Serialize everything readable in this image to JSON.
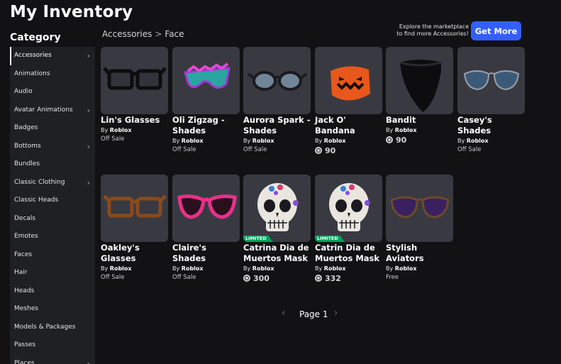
{
  "page_title": "My Inventory",
  "sidebar": {
    "heading": "Category",
    "items": [
      {
        "label": "Accessories",
        "chevron": true
      },
      {
        "label": "Animations",
        "chevron": false
      },
      {
        "label": "Audio",
        "chevron": false
      },
      {
        "label": "Avatar Animations",
        "chevron": true
      },
      {
        "label": "Badges",
        "chevron": false
      },
      {
        "label": "Bottoms",
        "chevron": true
      },
      {
        "label": "Bundles",
        "chevron": false
      },
      {
        "label": "Classic Clothing",
        "chevron": true
      },
      {
        "label": "Classic Heads",
        "chevron": false
      },
      {
        "label": "Decals",
        "chevron": false
      },
      {
        "label": "Emotes",
        "chevron": false
      },
      {
        "label": "Faces",
        "chevron": false
      },
      {
        "label": "Hair",
        "chevron": false
      },
      {
        "label": "Heads",
        "chevron": false
      },
      {
        "label": "Meshes",
        "chevron": false
      },
      {
        "label": "Models & Packages",
        "chevron": false
      },
      {
        "label": "Passes",
        "chevron": false
      },
      {
        "label": "Places",
        "chevron": true
      }
    ]
  },
  "breadcrumb": {
    "parent": "Accessories",
    "separator": ">",
    "current": "Face"
  },
  "promo": {
    "line1": "Explore the marketplace",
    "line2": "to find more Accessories!",
    "button": "Get More"
  },
  "items": [
    {
      "name": "Lin's Glasses",
      "by_prefix": "By",
      "creator": "Roblox",
      "price": "Off Sale",
      "robux": false,
      "limited": false,
      "icon": "black-glasses"
    },
    {
      "name": "Oli Zigzag - Shades",
      "by_prefix": "By",
      "creator": "Roblox",
      "price": "Off Sale",
      "robux": false,
      "limited": false,
      "icon": "zigzag-shades"
    },
    {
      "name": "Aurora Spark - Shades",
      "by_prefix": "By",
      "creator": "Roblox",
      "price": "Off Sale",
      "robux": false,
      "limited": false,
      "icon": "round-shades"
    },
    {
      "name": "Jack O' Bandana",
      "by_prefix": "By",
      "creator": "Roblox",
      "price": "90",
      "robux": true,
      "limited": false,
      "icon": "pumpkin-bandana"
    },
    {
      "name": "Bandit",
      "by_prefix": "By",
      "creator": "Roblox",
      "price": "90",
      "robux": true,
      "limited": false,
      "icon": "black-bandana"
    },
    {
      "name": "Casey's Shades",
      "by_prefix": "By",
      "creator": "Roblox",
      "price": "Off Sale",
      "robux": false,
      "limited": false,
      "icon": "aviator-shades"
    },
    {
      "name": "Oakley's Glasses",
      "by_prefix": "By",
      "creator": "Roblox",
      "price": "Off Sale",
      "robux": false,
      "limited": false,
      "icon": "brown-glasses"
    },
    {
      "name": "Claire's Shades",
      "by_prefix": "By",
      "creator": "Roblox",
      "price": "Off Sale",
      "robux": false,
      "limited": false,
      "icon": "pink-shades"
    },
    {
      "name": "Catrina Dia de Muertos Mask",
      "by_prefix": "By",
      "creator": "Roblox",
      "price": "300",
      "robux": true,
      "limited": true,
      "limited_label": "LIMITED",
      "icon": "skull-mask"
    },
    {
      "name": "Catrin Dia de Muertos Mask",
      "by_prefix": "By",
      "creator": "Roblox",
      "price": "332",
      "robux": true,
      "limited": true,
      "limited_label": "LIMITED",
      "icon": "skull-mask"
    },
    {
      "name": "Stylish Aviators",
      "by_prefix": "By",
      "creator": "Roblox",
      "price": "Free",
      "robux": false,
      "limited": false,
      "icon": "stylish-aviators"
    }
  ],
  "pagination": {
    "prev": "‹",
    "label": "Page 1",
    "next": "›"
  }
}
